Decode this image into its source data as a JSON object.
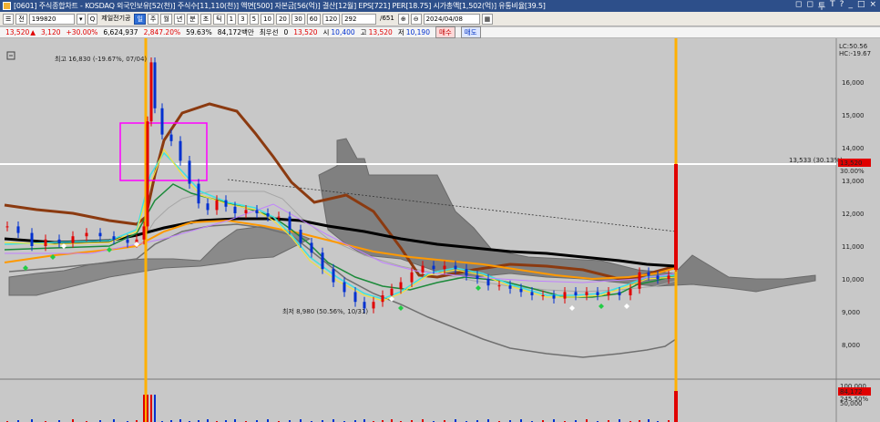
{
  "window": {
    "title": "[0601] 주식종합차트 - KOSDAQ 외국인보유[52(천)] 주식수[11,110(천)] 액면[500] 자본금[56(억)] 결산[12월] EPS[721] PER[18.75] 시가총액[1,502(억)] 유통비율[39.5]",
    "controls": [
      "◻",
      "◻",
      "투",
      "T",
      "?",
      "_",
      "□",
      "×"
    ]
  },
  "toolbar": {
    "menu_icon": "☰",
    "market_select": "전",
    "stock_code": "199820",
    "search_icon": "Q",
    "stock_name": "제일전기공",
    "periods": [
      "일",
      "주",
      "월",
      "년",
      "분",
      "초",
      "틱"
    ],
    "selected_period": "일",
    "intervals": [
      "1",
      "3",
      "5",
      "10",
      "20",
      "30",
      "60",
      "120"
    ],
    "bar_count": "292",
    "bar_total": "/651",
    "date": "2024/04/08"
  },
  "quote": {
    "price": "13,520",
    "arrow": "▲",
    "change": "3,120",
    "change_pct": "+30.00%",
    "volume": "6,624,937",
    "amount": "2,847.20%",
    "turnover": "59.63%",
    "value": "84,172백만",
    "credit_label": "최우선",
    "credit_value": "0",
    "last": "13,520",
    "open_label": "시",
    "open": "10,400",
    "high_label": "고",
    "high": "13,520",
    "low_label": "저",
    "low": "10,190",
    "buy_label": "매수",
    "sell_label": "매도"
  },
  "chart": {
    "lc_label": "LC:50.56",
    "hc_label": "HC:-19.67",
    "high_annotation": "최고 16,830 (-19.67%, 07/04)",
    "low_annotation": "최저 8,980 (50.56%, 10/31)",
    "mid_annotation": "13,533 (30.13%)",
    "current_price_badge": "13,520",
    "current_pct_badge": "30.00%",
    "price_axis_ticks": [
      "16,000",
      "15,000",
      "14,000",
      "13,000",
      "12,000",
      "11,000",
      "10,000",
      "9,000",
      "8,000"
    ],
    "volume_axis_ticks": [
      "100,000",
      "50,000"
    ],
    "volume_badge": "84,172",
    "volume_pct_badge": "245.50%"
  },
  "colors": {
    "background": "#c8c8c8",
    "candle_up": "#e00000",
    "candle_down": "#0030d0",
    "ma_long": "#000000",
    "ma_brown": "#8b3a10",
    "ma_orange": "#ff9900",
    "ma_green": "#1c8a3a",
    "cloud": "#808080",
    "highlight_box": "#ff00ff",
    "vertical_marker": "#ffb000"
  },
  "chart_data": {
    "type": "candlestick",
    "ylim": [
      7500,
      17000
    ],
    "y_ticks": [
      8000,
      9000,
      10000,
      11000,
      12000,
      13000,
      14000,
      15000,
      16000
    ],
    "last_price": 13520,
    "high": 16830,
    "low": 8980,
    "annotated_level": 13533
  }
}
